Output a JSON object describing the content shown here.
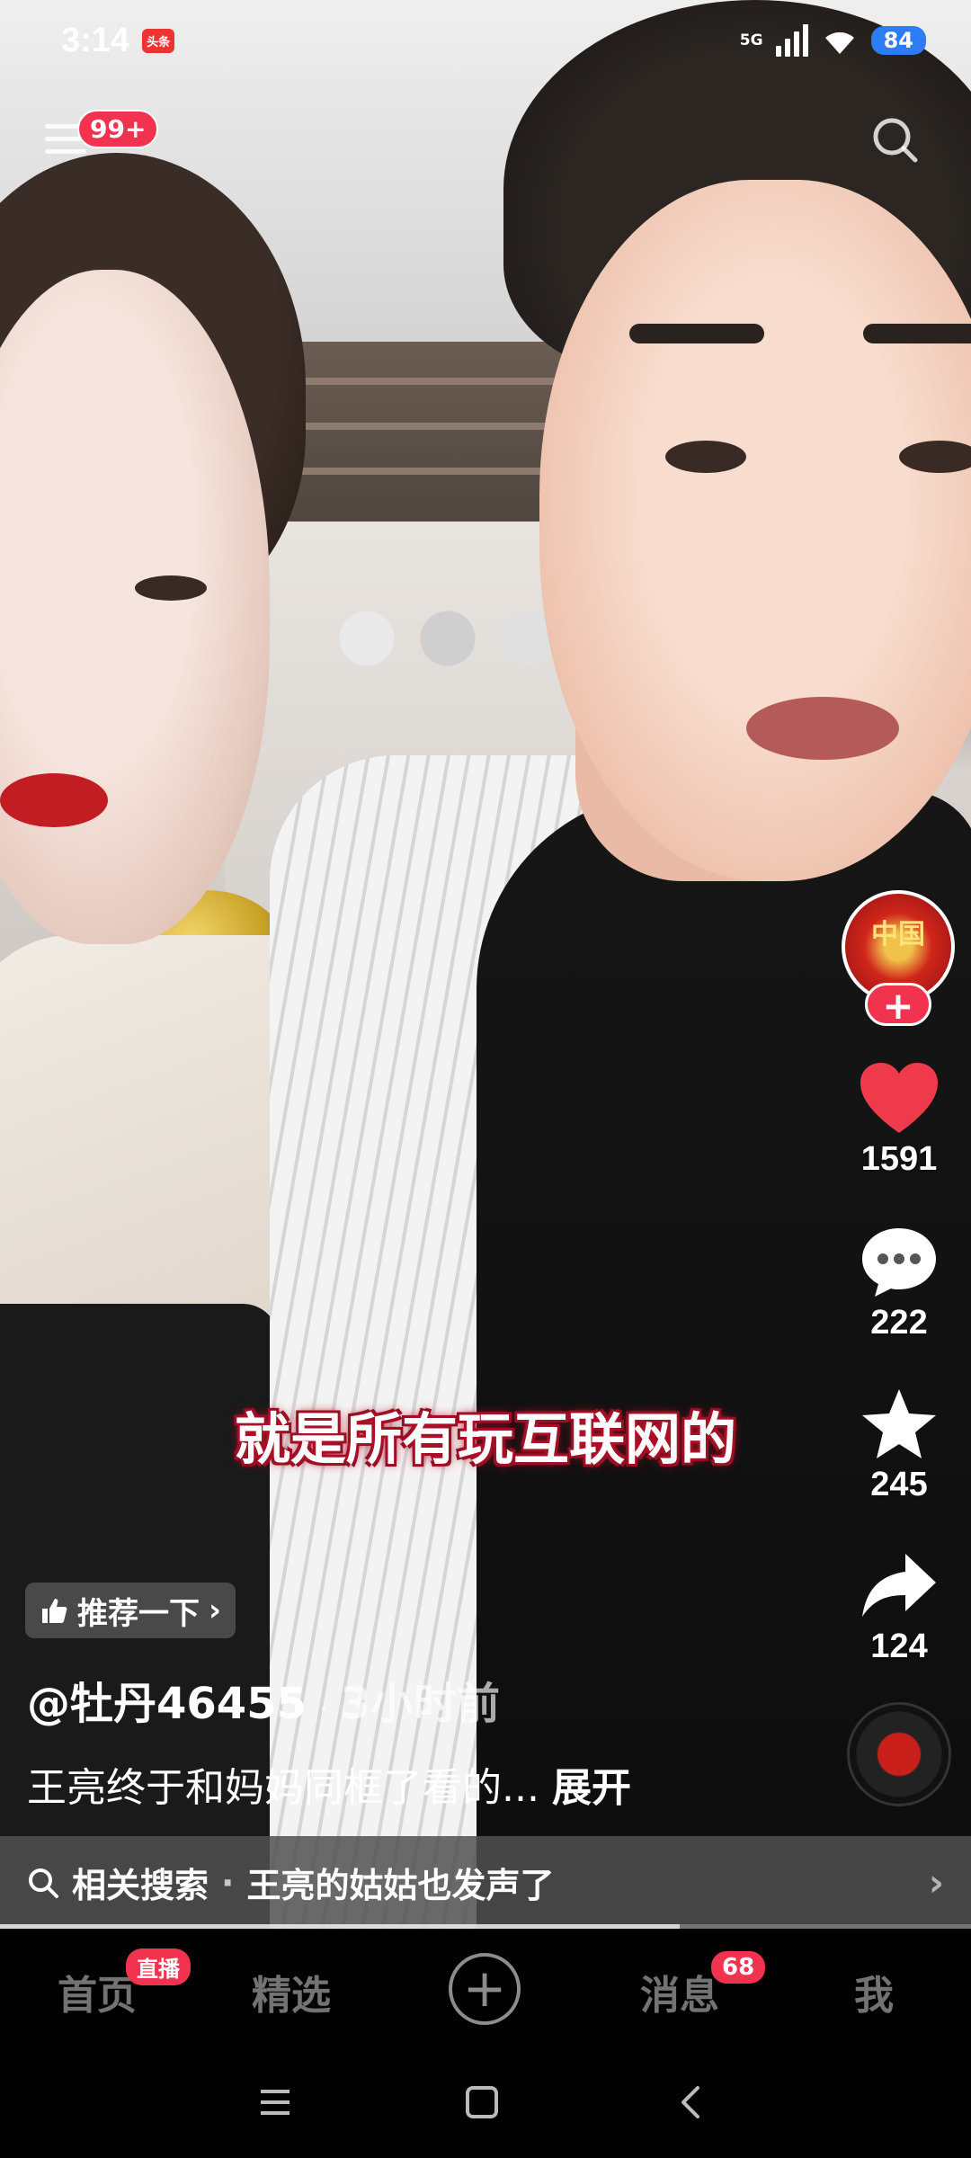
{
  "status_bar": {
    "time": "3:14",
    "app_badge": "头条",
    "network": "5G",
    "battery": "84"
  },
  "top_bar": {
    "menu_badge": "99+"
  },
  "video": {
    "subtitle": "就是所有玩互联网的"
  },
  "right_rail": {
    "avatar_label": "中国",
    "follow_label": "+",
    "likes": "1591",
    "comments": "222",
    "favorites": "245",
    "shares": "124"
  },
  "post": {
    "recommend_label": "推荐一下",
    "author": "@牡丹46455",
    "separator": "·",
    "time_ago": "3小时前",
    "caption": "王亮终于和妈妈同框了看的... ",
    "expand_label": "展开"
  },
  "related_search": {
    "label": "相关搜索",
    "separator": "·",
    "query": "王亮的姑姑也发声了"
  },
  "playback": {
    "progress": 0.7
  },
  "bottom_nav": {
    "home": "首页",
    "live_badge": "直播",
    "featured": "精选",
    "add": "+",
    "messages": "消息",
    "messages_badge": "68",
    "me": "我"
  },
  "colors": {
    "accent": "#f2334f",
    "like": "#ee3a4a",
    "battery": "#2b7cf5"
  }
}
